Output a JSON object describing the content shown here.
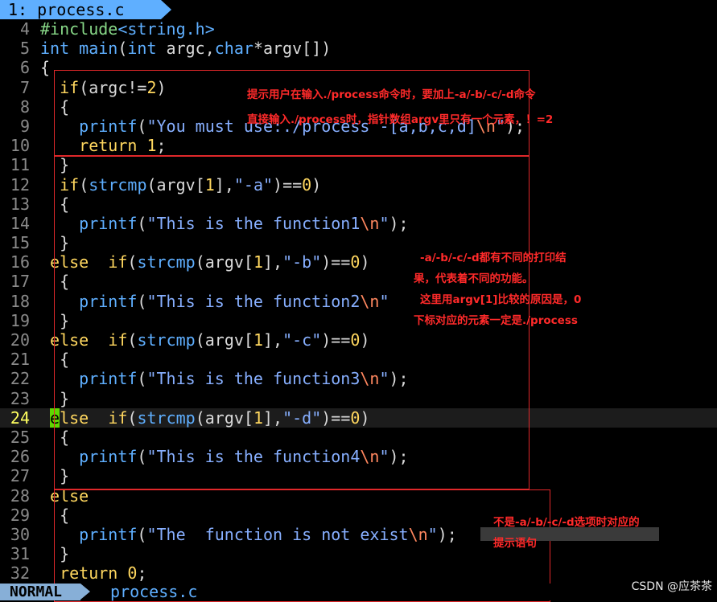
{
  "tab": {
    "label": "1: process.c"
  },
  "lines": [
    {
      "n": "4",
      "segs": [
        {
          "c": "pp",
          "t": "#include"
        },
        {
          "c": "inc",
          "t": "<string.h>"
        }
      ]
    },
    {
      "n": "5",
      "segs": [
        {
          "c": "ty",
          "t": "int"
        },
        {
          "c": "",
          "t": " "
        },
        {
          "c": "fn",
          "t": "main"
        },
        {
          "c": "",
          "t": "("
        },
        {
          "c": "ty",
          "t": "int"
        },
        {
          "c": "",
          "t": " argc,"
        },
        {
          "c": "ty",
          "t": "char"
        },
        {
          "c": "",
          "t": "*argv[])"
        }
      ]
    },
    {
      "n": "6",
      "segs": [
        {
          "c": "",
          "t": "{"
        }
      ]
    },
    {
      "n": "7",
      "segs": [
        {
          "c": "",
          "t": "  "
        },
        {
          "c": "kw",
          "t": "if"
        },
        {
          "c": "",
          "t": "(argc!="
        },
        {
          "c": "num",
          "t": "2"
        },
        {
          "c": "",
          "t": ")"
        }
      ]
    },
    {
      "n": "8",
      "segs": [
        {
          "c": "",
          "t": "  {"
        }
      ]
    },
    {
      "n": "9",
      "segs": [
        {
          "c": "",
          "t": "    "
        },
        {
          "c": "fn",
          "t": "printf"
        },
        {
          "c": "",
          "t": "("
        },
        {
          "c": "str",
          "t": "\"You must use:./process -[a,b,c,d]"
        },
        {
          "c": "esc",
          "t": "\\n"
        },
        {
          "c": "str",
          "t": "\""
        },
        {
          "c": "",
          "t": ");"
        }
      ]
    },
    {
      "n": "10",
      "segs": [
        {
          "c": "",
          "t": "    "
        },
        {
          "c": "kw",
          "t": "return"
        },
        {
          "c": "",
          "t": " "
        },
        {
          "c": "num",
          "t": "1"
        },
        {
          "c": "",
          "t": ";"
        }
      ]
    },
    {
      "n": "11",
      "segs": [
        {
          "c": "",
          "t": "  }"
        }
      ]
    },
    {
      "n": "12",
      "segs": [
        {
          "c": "",
          "t": "  "
        },
        {
          "c": "kw",
          "t": "if"
        },
        {
          "c": "",
          "t": "("
        },
        {
          "c": "fn",
          "t": "strcmp"
        },
        {
          "c": "",
          "t": "(argv["
        },
        {
          "c": "num",
          "t": "1"
        },
        {
          "c": "",
          "t": "],"
        },
        {
          "c": "str",
          "t": "\"-a\""
        },
        {
          "c": "",
          "t": ")=="
        },
        {
          "c": "num",
          "t": "0"
        },
        {
          "c": "",
          "t": ")"
        }
      ]
    },
    {
      "n": "13",
      "segs": [
        {
          "c": "",
          "t": "  {"
        }
      ]
    },
    {
      "n": "14",
      "segs": [
        {
          "c": "",
          "t": "    "
        },
        {
          "c": "fn",
          "t": "printf"
        },
        {
          "c": "",
          "t": "("
        },
        {
          "c": "str",
          "t": "\"This is the function1"
        },
        {
          "c": "esc",
          "t": "\\n"
        },
        {
          "c": "str",
          "t": "\""
        },
        {
          "c": "",
          "t": ");"
        }
      ]
    },
    {
      "n": "15",
      "segs": [
        {
          "c": "",
          "t": "  }"
        }
      ]
    },
    {
      "n": "16",
      "segs": [
        {
          "c": "",
          "t": " "
        },
        {
          "c": "kw",
          "t": "else"
        },
        {
          "c": "",
          "t": "  "
        },
        {
          "c": "kw",
          "t": "if"
        },
        {
          "c": "",
          "t": "("
        },
        {
          "c": "fn",
          "t": "strcmp"
        },
        {
          "c": "",
          "t": "(argv["
        },
        {
          "c": "num",
          "t": "1"
        },
        {
          "c": "",
          "t": "],"
        },
        {
          "c": "str",
          "t": "\"-b\""
        },
        {
          "c": "",
          "t": ")=="
        },
        {
          "c": "num",
          "t": "0"
        },
        {
          "c": "",
          "t": ")"
        }
      ]
    },
    {
      "n": "17",
      "segs": [
        {
          "c": "",
          "t": "  {"
        }
      ]
    },
    {
      "n": "18",
      "segs": [
        {
          "c": "",
          "t": "    "
        },
        {
          "c": "fn",
          "t": "printf"
        },
        {
          "c": "",
          "t": "("
        },
        {
          "c": "str",
          "t": "\"This is the function2"
        },
        {
          "c": "esc",
          "t": "\\n"
        },
        {
          "c": "str",
          "t": "\""
        }
      ]
    },
    {
      "n": "19",
      "segs": [
        {
          "c": "",
          "t": "  }"
        }
      ]
    },
    {
      "n": "20",
      "segs": [
        {
          "c": "",
          "t": " "
        },
        {
          "c": "kw",
          "t": "else"
        },
        {
          "c": "",
          "t": "  "
        },
        {
          "c": "kw",
          "t": "if"
        },
        {
          "c": "",
          "t": "("
        },
        {
          "c": "fn",
          "t": "strcmp"
        },
        {
          "c": "",
          "t": "(argv["
        },
        {
          "c": "num",
          "t": "1"
        },
        {
          "c": "",
          "t": "],"
        },
        {
          "c": "str",
          "t": "\"-c\""
        },
        {
          "c": "",
          "t": ")=="
        },
        {
          "c": "num",
          "t": "0"
        },
        {
          "c": "",
          "t": ")"
        }
      ]
    },
    {
      "n": "21",
      "segs": [
        {
          "c": "",
          "t": "  {"
        }
      ]
    },
    {
      "n": "22",
      "segs": [
        {
          "c": "",
          "t": "    "
        },
        {
          "c": "fn",
          "t": "printf"
        },
        {
          "c": "",
          "t": "("
        },
        {
          "c": "str",
          "t": "\"This is the function3"
        },
        {
          "c": "esc",
          "t": "\\n"
        },
        {
          "c": "str",
          "t": "\""
        },
        {
          "c": "",
          "t": ");"
        }
      ]
    },
    {
      "n": "23",
      "segs": [
        {
          "c": "",
          "t": "  }"
        }
      ]
    },
    {
      "n": "24",
      "cur": true,
      "segs": [
        {
          "c": "",
          "t": " "
        },
        {
          "c": "cursor",
          "t": "e"
        },
        {
          "c": "kw",
          "t": "lse"
        },
        {
          "c": "",
          "t": "  "
        },
        {
          "c": "kw",
          "t": "if"
        },
        {
          "c": "",
          "t": "("
        },
        {
          "c": "fn",
          "t": "strcmp"
        },
        {
          "c": "",
          "t": "(argv["
        },
        {
          "c": "num",
          "t": "1"
        },
        {
          "c": "",
          "t": "],"
        },
        {
          "c": "str",
          "t": "\"-d\""
        },
        {
          "c": "",
          "t": ")=="
        },
        {
          "c": "num",
          "t": "0"
        },
        {
          "c": "",
          "t": ")"
        }
      ]
    },
    {
      "n": "25",
      "segs": [
        {
          "c": "",
          "t": "  {"
        }
      ]
    },
    {
      "n": "26",
      "segs": [
        {
          "c": "",
          "t": "    "
        },
        {
          "c": "fn",
          "t": "printf"
        },
        {
          "c": "",
          "t": "("
        },
        {
          "c": "str",
          "t": "\"This is the function4"
        },
        {
          "c": "esc",
          "t": "\\n"
        },
        {
          "c": "str",
          "t": "\""
        },
        {
          "c": "",
          "t": ");"
        }
      ]
    },
    {
      "n": "27",
      "segs": [
        {
          "c": "",
          "t": "  }"
        }
      ]
    },
    {
      "n": "28",
      "segs": [
        {
          "c": "",
          "t": " "
        },
        {
          "c": "kw",
          "t": "else"
        }
      ]
    },
    {
      "n": "29",
      "segs": [
        {
          "c": "",
          "t": "  {"
        }
      ]
    },
    {
      "n": "30",
      "segs": [
        {
          "c": "",
          "t": "    "
        },
        {
          "c": "fn",
          "t": "printf"
        },
        {
          "c": "",
          "t": "("
        },
        {
          "c": "str",
          "t": "\"The  function is not exist"
        },
        {
          "c": "esc",
          "t": "\\n"
        },
        {
          "c": "str",
          "t": "\""
        },
        {
          "c": "",
          "t": ");"
        }
      ]
    },
    {
      "n": "31",
      "segs": [
        {
          "c": "",
          "t": "  }"
        }
      ]
    },
    {
      "n": "32",
      "segs": [
        {
          "c": "",
          "t": "  "
        },
        {
          "c": "kw",
          "t": "return"
        },
        {
          "c": "",
          "t": " "
        },
        {
          "c": "num",
          "t": "0"
        },
        {
          "c": "",
          "t": ";"
        }
      ]
    }
  ],
  "annotations": {
    "note1_line1": "提示用户在输入./process命令时，要加上-a/-b/-c/-d命令",
    "note1_line2": "直接输入./process时，指针数组argv里只有一个元素，！=2",
    "note2_line1": "-a/-b/-c/-d都有不同的打印结",
    "note2_line2": "果，代表着不同的功能。",
    "note2_line3": "这里用argv[1]比较的原因是，0",
    "note2_line4": "下标对应的元素一定是./process",
    "note3_line1": "不是-a/-b/-c/-d选项时对应的",
    "note3_line2": "提示语句"
  },
  "status": {
    "mode": "NORMAL",
    "filename": "process.c"
  },
  "watermark": "CSDN @应茶茶",
  "colors": {
    "accent": "#5fafff",
    "annotation": "#ff2a2a",
    "cursor": "#5fd700"
  }
}
